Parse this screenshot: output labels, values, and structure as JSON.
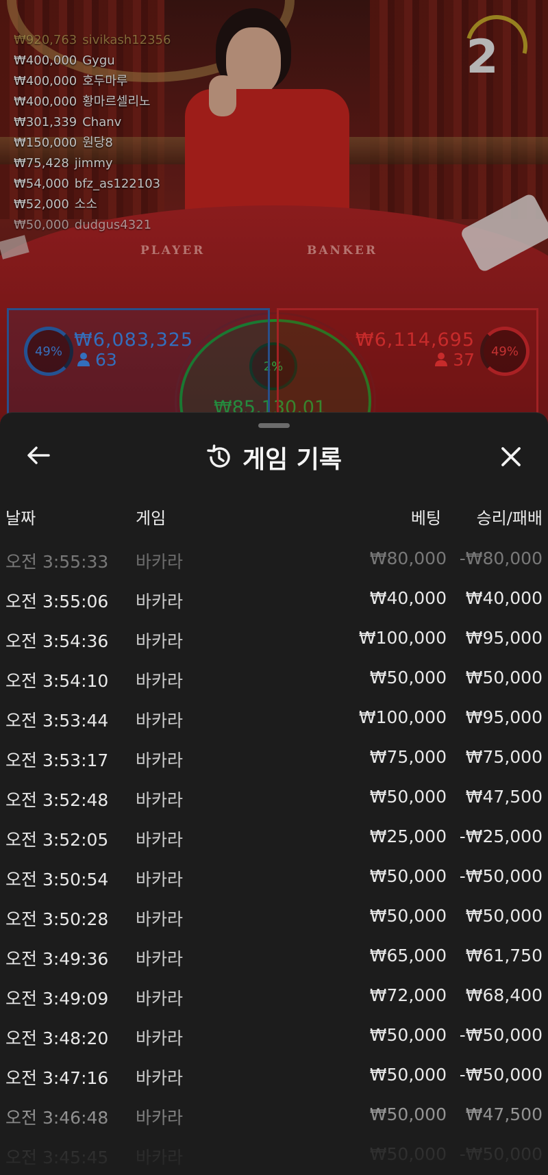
{
  "game_scene": {
    "timer": "2",
    "table_labels": {
      "player": "PLAYER",
      "banker": "BANKER"
    },
    "bet_feed": [
      {
        "amount": "₩920,763",
        "user": "sivikash12356"
      },
      {
        "amount": "₩400,000",
        "user": "Gygu"
      },
      {
        "amount": "₩400,000",
        "user": "호두마루"
      },
      {
        "amount": "₩400,000",
        "user": "황마르셀리노"
      },
      {
        "amount": "₩301,339",
        "user": "Chanv"
      },
      {
        "amount": "₩150,000",
        "user": "원당8"
      },
      {
        "amount": "₩75,428",
        "user": "jimmy"
      },
      {
        "amount": "₩54,000",
        "user": "bfz_as122103"
      },
      {
        "amount": "₩52,000",
        "user": "소소"
      },
      {
        "amount": "₩50,000",
        "user": "dudgus4321"
      }
    ],
    "player": {
      "percent": "49%",
      "amount": "₩6,083,325",
      "players": "63",
      "color": "#3b7fd8"
    },
    "banker": {
      "percent": "49%",
      "amount": "₩6,114,695",
      "players": "37",
      "color": "#e33232"
    },
    "tie": {
      "percent": "2%",
      "amount": "₩85,130.01",
      "color": "#2db53c"
    }
  },
  "sheet": {
    "title": "게임 기록",
    "icons": {
      "back": "arrow-left-icon",
      "history": "history-icon",
      "close": "close-icon"
    },
    "columns": {
      "date": "날짜",
      "game": "게임",
      "bet": "베팅",
      "result": "승리/패배"
    },
    "rows": [
      {
        "date": "오전 3:55:33",
        "game": "바카라",
        "bet": "₩80,000",
        "result": "-₩80,000"
      },
      {
        "date": "오전 3:55:06",
        "game": "바카라",
        "bet": "₩40,000",
        "result": "₩40,000"
      },
      {
        "date": "오전 3:54:36",
        "game": "바카라",
        "bet": "₩100,000",
        "result": "₩95,000"
      },
      {
        "date": "오전 3:54:10",
        "game": "바카라",
        "bet": "₩50,000",
        "result": "₩50,000"
      },
      {
        "date": "오전 3:53:44",
        "game": "바카라",
        "bet": "₩100,000",
        "result": "₩95,000"
      },
      {
        "date": "오전 3:53:17",
        "game": "바카라",
        "bet": "₩75,000",
        "result": "₩75,000"
      },
      {
        "date": "오전 3:52:48",
        "game": "바카라",
        "bet": "₩50,000",
        "result": "₩47,500"
      },
      {
        "date": "오전 3:52:05",
        "game": "바카라",
        "bet": "₩25,000",
        "result": "-₩25,000"
      },
      {
        "date": "오전 3:50:54",
        "game": "바카라",
        "bet": "₩50,000",
        "result": "-₩50,000"
      },
      {
        "date": "오전 3:50:28",
        "game": "바카라",
        "bet": "₩50,000",
        "result": "₩50,000"
      },
      {
        "date": "오전 3:49:36",
        "game": "바카라",
        "bet": "₩65,000",
        "result": "₩61,750"
      },
      {
        "date": "오전 3:49:09",
        "game": "바카라",
        "bet": "₩72,000",
        "result": "₩68,400"
      },
      {
        "date": "오전 3:48:20",
        "game": "바카라",
        "bet": "₩50,000",
        "result": "-₩50,000"
      },
      {
        "date": "오전 3:47:16",
        "game": "바카라",
        "bet": "₩50,000",
        "result": "-₩50,000"
      },
      {
        "date": "오전 3:46:48",
        "game": "바카라",
        "bet": "₩50,000",
        "result": "₩47,500"
      },
      {
        "date": "오전 3:45:45",
        "game": "바카라",
        "bet": "₩50,000",
        "result": "-₩50,000"
      }
    ]
  }
}
